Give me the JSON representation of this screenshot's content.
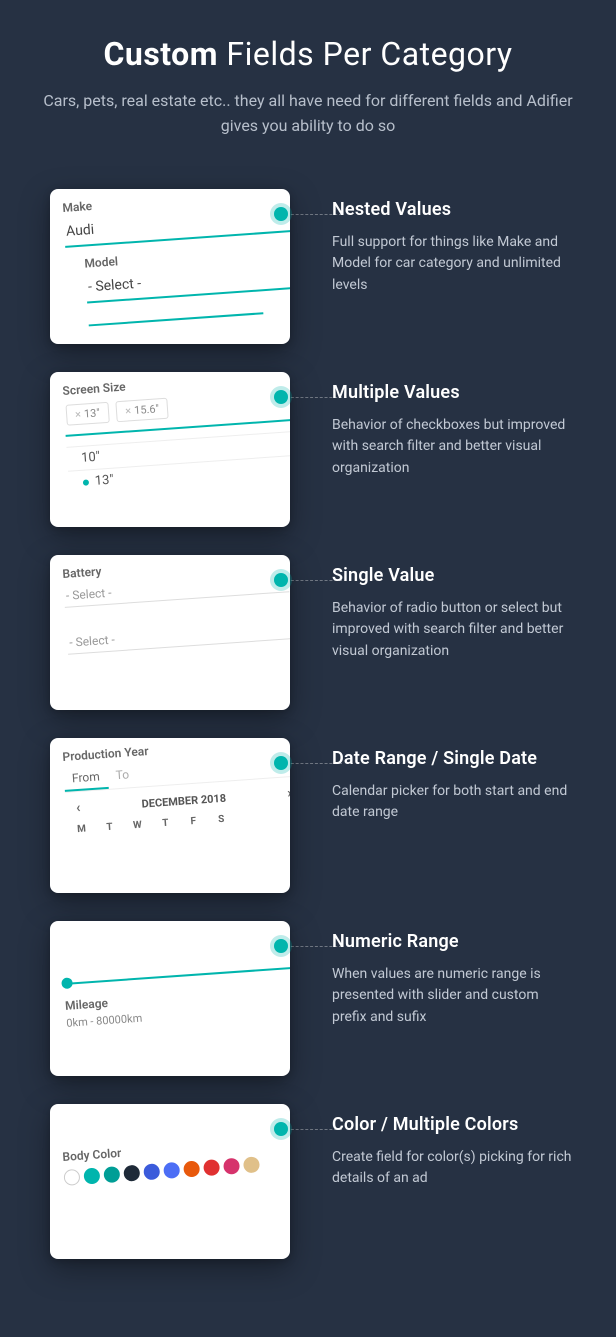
{
  "heading": {
    "title_bold": "Custom",
    "title_rest": " Fields Per Category",
    "subtitle": "Cars, pets, real estate etc.. they all have need for different fields and Adifier gives you ability to do so"
  },
  "features": [
    {
      "title": "Nested Values",
      "desc": "Full support for things like Make and Model for car category and unlimited levels",
      "card": {
        "label1": "Make",
        "value1": "Audi",
        "label2": "Model",
        "value2": "- Select -"
      }
    },
    {
      "title": "Multiple Values",
      "desc": "Behavior of checkboxes but improved with search filter and better visual organization",
      "card": {
        "label": "Screen Size",
        "chip1": "13\"",
        "chip2": "15.6\"",
        "opt1": "10\"",
        "opt2": "13\""
      }
    },
    {
      "title": "Single Value",
      "desc": "Behavior of radio button or select but  improved with search filter and better visual organization",
      "card": {
        "label": "Battery",
        "ph1": "- Select -",
        "ph2": "- Select -"
      }
    },
    {
      "title": "Date Range / Single Date",
      "desc": "Calendar picker for both start and end date range",
      "card": {
        "label": "Production Year",
        "tab1": "From",
        "tab2": "To",
        "month": "DECEMBER 2018",
        "days": [
          "M",
          "T",
          "W",
          "T",
          "F",
          "S"
        ]
      }
    },
    {
      "title": "Numeric Range",
      "desc": "When values are numeric range is presented with slider and custom prefix and sufix",
      "card": {
        "label": "Mileage",
        "range": "0km - 80000km"
      }
    },
    {
      "title": "Color / Multiple Colors",
      "desc": "Create field for color(s) picking for rich details of an ad",
      "card": {
        "label": "Body Color",
        "colors": [
          "#ffffff",
          "#00b5ad",
          "#009e96",
          "#1e2a38",
          "#3b5bdb",
          "#4c6ef5",
          "#e8590c",
          "#e03131",
          "#d6336c",
          "#e0c089"
        ]
      }
    }
  ]
}
